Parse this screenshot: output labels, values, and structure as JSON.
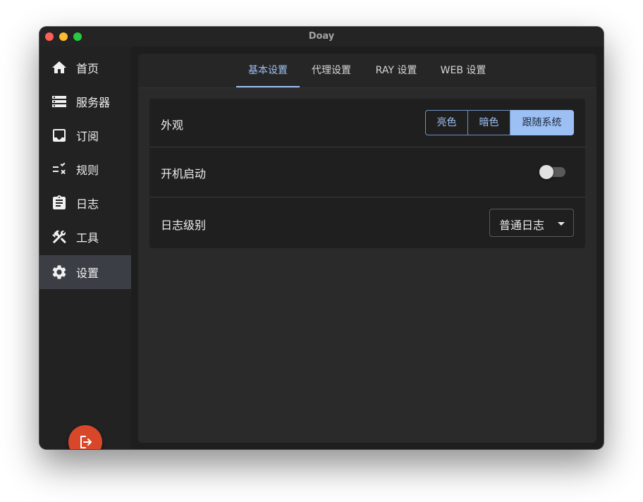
{
  "window": {
    "title": "Doay"
  },
  "sidebar": {
    "items": [
      {
        "label": "首页",
        "icon": "home-icon",
        "active": false
      },
      {
        "label": "服务器",
        "icon": "server-list-icon",
        "active": false
      },
      {
        "label": "订阅",
        "icon": "inbox-icon",
        "active": false
      },
      {
        "label": "规则",
        "icon": "rules-checklist-icon",
        "active": false
      },
      {
        "label": "日志",
        "icon": "clipboard-icon",
        "active": false
      },
      {
        "label": "工具",
        "icon": "tools-icon",
        "active": false
      },
      {
        "label": "设置",
        "icon": "gear-icon",
        "active": true
      }
    ],
    "exit_icon": "logout-icon"
  },
  "tabs": [
    {
      "label": "基本设置",
      "active": true
    },
    {
      "label": "代理设置",
      "active": false
    },
    {
      "label": "RAY 设置",
      "active": false
    },
    {
      "label": "WEB 设置",
      "active": false
    }
  ],
  "settings": {
    "appearance": {
      "label": "外观",
      "options": [
        "亮色",
        "暗色",
        "跟随系统"
      ],
      "selected": "跟随系统"
    },
    "autostart": {
      "label": "开机启动",
      "enabled": false
    },
    "log_level": {
      "label": "日志级别",
      "value": "普通日志"
    }
  },
  "colors": {
    "accent": "#9dc0f4",
    "exit_button": "#d9472b",
    "sidebar_active": "#3b3f45"
  }
}
